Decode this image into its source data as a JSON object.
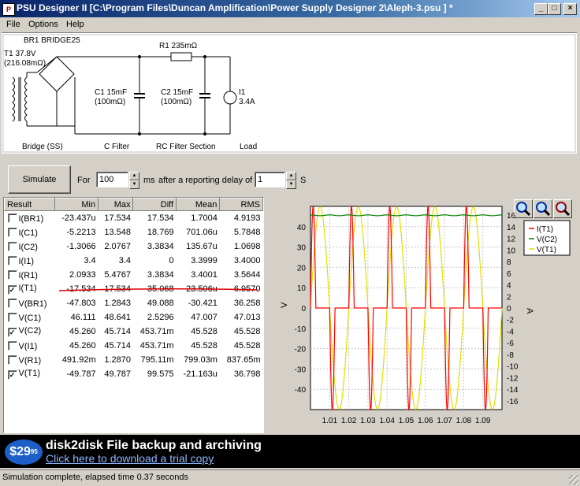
{
  "window": {
    "title": "PSU Designer II  [C:\\Program Files\\Duncan Amplification\\Power Supply Designer 2\\Aleph-3.psu ] *"
  },
  "menu": [
    "File",
    "Options",
    "Help"
  ],
  "schematic": {
    "bridge_label": "BR1 BRIDGE25",
    "transformer_label_1": "T1 37.8V",
    "transformer_label_2": "(216.08mΩ)",
    "c1_label_1": "C1 15mF",
    "c1_label_2": "(100mΩ)",
    "r1_label": "R1 235mΩ",
    "c2_label_1": "C2 15mF",
    "c2_label_2": "(100mΩ)",
    "i1_label_1": "I1",
    "i1_label_2": "3.4A",
    "sections": [
      "Bridge (SS)",
      "C Filter",
      "RC Filter Section",
      "Load"
    ]
  },
  "controls": {
    "simulate_label": "Simulate",
    "for_label": "For",
    "duration_value": "100",
    "ms_label": "ms",
    "after_label": "after a reporting delay of",
    "delay_value": "1",
    "s_label": "S"
  },
  "results": {
    "columns": [
      "Result",
      "Min",
      "Max",
      "Diff",
      "Mean",
      "RMS"
    ],
    "rows": [
      {
        "name": "I(BR1)",
        "checked": false,
        "min": "-23.437u",
        "max": "17.534",
        "diff": "17.534",
        "mean": "1.7004",
        "rms": "4.9193"
      },
      {
        "name": "I(C1)",
        "checked": false,
        "min": "-5.2213",
        "max": "13.548",
        "diff": "18.769",
        "mean": "701.06u",
        "rms": "5.7848"
      },
      {
        "name": "I(C2)",
        "checked": false,
        "min": "-1.3066",
        "max": "2.0767",
        "diff": "3.3834",
        "mean": "135.67u",
        "rms": "1.0698"
      },
      {
        "name": "I(I1)",
        "checked": false,
        "min": "3.4",
        "max": "3.4",
        "diff": "0",
        "mean": "3.3999",
        "rms": "3.4000"
      },
      {
        "name": "I(R1)",
        "checked": false,
        "min": "2.0933",
        "max": "5.4767",
        "diff": "3.3834",
        "mean": "3.4001",
        "rms": "3.5644"
      },
      {
        "name": "I(T1)",
        "checked": true,
        "min": "-17.534",
        "max": "17.534",
        "diff": "35.068",
        "mean": "-23.506u",
        "rms": "6.9570"
      },
      {
        "name": "V(BR1)",
        "checked": false,
        "min": "-47.803",
        "max": "1.2843",
        "diff": "49.088",
        "mean": "-30.421",
        "rms": "36.258"
      },
      {
        "name": "V(C1)",
        "checked": false,
        "min": "46.111",
        "max": "48.641",
        "diff": "2.5296",
        "mean": "47.007",
        "rms": "47.013"
      },
      {
        "name": "V(C2)",
        "checked": true,
        "min": "45.260",
        "max": "45.714",
        "diff": "453.71m",
        "mean": "45.528",
        "rms": "45.528"
      },
      {
        "name": "V(I1)",
        "checked": false,
        "min": "45.260",
        "max": "45.714",
        "diff": "453.71m",
        "mean": "45.528",
        "rms": "45.528"
      },
      {
        "name": "V(R1)",
        "checked": false,
        "min": "491.92m",
        "max": "1.2870",
        "diff": "795.11m",
        "mean": "799.03m",
        "rms": "837.65m"
      },
      {
        "name": "V(T1)",
        "checked": true,
        "min": "-49.787",
        "max": "49.787",
        "diff": "99.575",
        "mean": "-21.163u",
        "rms": "36.798"
      }
    ]
  },
  "chart_data": {
    "type": "line",
    "xlabel": "",
    "ylabel": "V",
    "y2label": "A",
    "xlim": [
      1.0,
      1.1
    ],
    "ylim": [
      -50,
      50
    ],
    "y2lim": [
      -17.5,
      17.5
    ],
    "xticks": [
      "1.01",
      "1.02",
      "1.03",
      "1.04",
      "1.05",
      "1.06",
      "1.07",
      "1.08",
      "1.09"
    ],
    "yticks": [
      40,
      30,
      20,
      10,
      0,
      -10,
      -20,
      -30,
      -40
    ],
    "y2ticks": [
      16,
      14,
      12,
      10,
      8,
      6,
      4,
      2,
      0,
      -2,
      -4,
      -6,
      -8,
      -10,
      -12,
      -14,
      -16
    ],
    "grid": true,
    "legend": "top-right",
    "series": [
      {
        "name": "I(T1)",
        "color": "#ff0000",
        "axis": "right",
        "period": 0.01,
        "peak": 17.534,
        "conduction_fraction": 0.28
      },
      {
        "name": "V(C2)",
        "color": "#008000",
        "axis": "left",
        "values_approx": [
          45.5,
          45.7
        ]
      },
      {
        "name": "V(T1)",
        "color": "#e0e000",
        "axis": "left",
        "period": 0.02,
        "peak": 49.787
      }
    ]
  },
  "ad": {
    "price_main": "$29",
    "price_cents": "95",
    "headline": "disk2disk File backup and archiving",
    "link": "Click here to download a trial copy"
  },
  "status": {
    "text": "Simulation complete, elapsed time 0.37 seconds"
  }
}
